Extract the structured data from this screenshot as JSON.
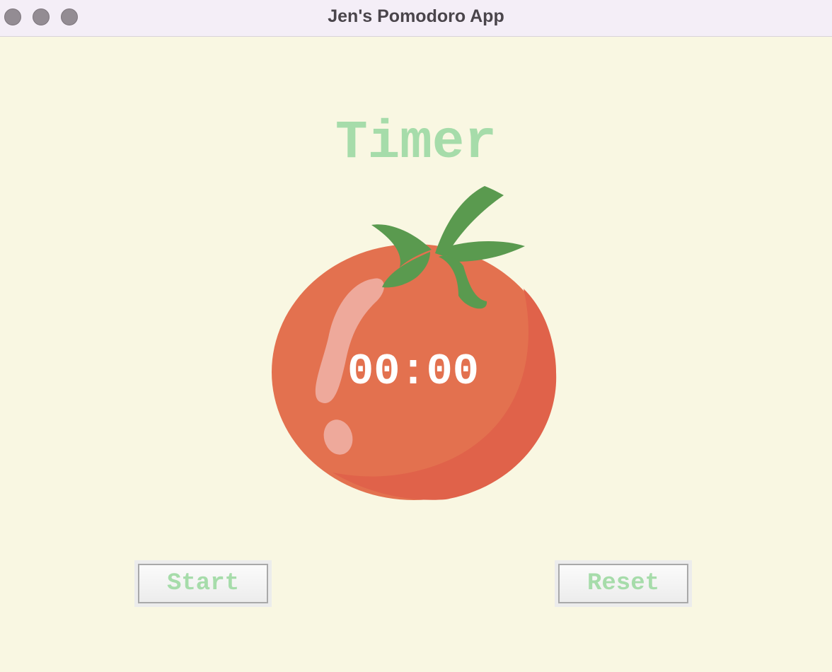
{
  "window": {
    "title": "Jen's Pomodoro App"
  },
  "main": {
    "heading": "Timer",
    "countdown": "00:00",
    "start_label": "Start",
    "reset_label": "Reset"
  },
  "colors": {
    "background": "#f9f7e2",
    "accent_green": "#a6dcaa",
    "tomato_red": "#e3714f",
    "stem_green": "#5a9a4f"
  },
  "icons": [
    "close-icon",
    "minimize-icon",
    "maximize-icon",
    "tomato-icon"
  ]
}
